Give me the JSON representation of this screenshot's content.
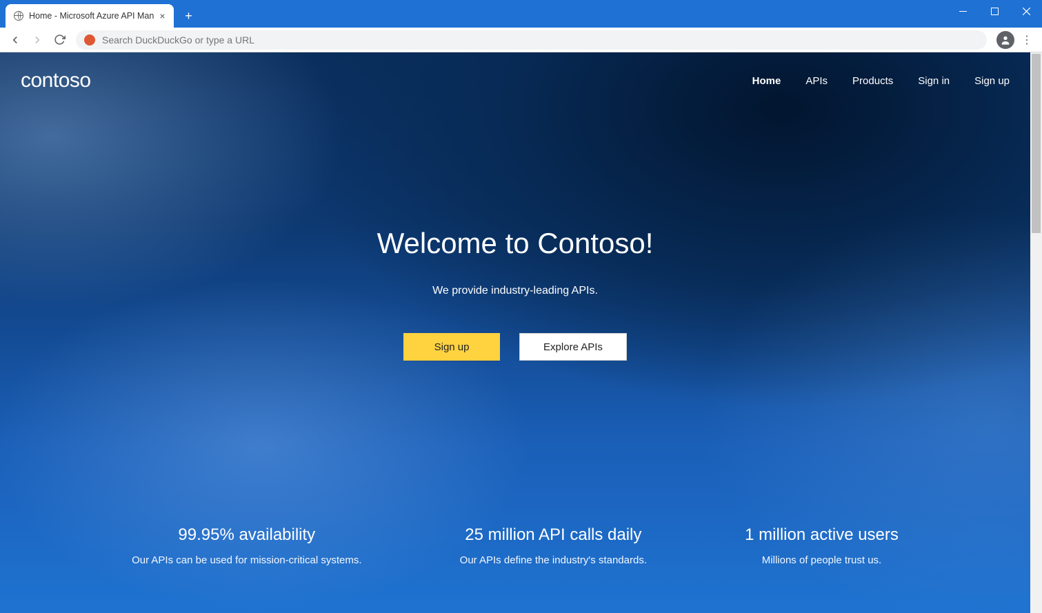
{
  "browser": {
    "tab_title": "Home - Microsoft Azure API Man",
    "omnibox_placeholder": "Search DuckDuckGo or type a URL"
  },
  "header": {
    "brand": "contoso",
    "nav": [
      {
        "label": "Home",
        "active": true
      },
      {
        "label": "APIs",
        "active": false
      },
      {
        "label": "Products",
        "active": false
      },
      {
        "label": "Sign in",
        "active": false
      },
      {
        "label": "Sign up",
        "active": false
      }
    ]
  },
  "hero": {
    "title": "Welcome to Contoso!",
    "subtitle": "We provide industry-leading APIs.",
    "primary_button": "Sign up",
    "secondary_button": "Explore APIs"
  },
  "stats": [
    {
      "headline": "99.95% availability",
      "sub": "Our APIs can be used for mission-critical systems."
    },
    {
      "headline": "25 million API calls daily",
      "sub": "Our APIs define the industry's standards."
    },
    {
      "headline": "1 million active users",
      "sub": "Millions of people trust us."
    }
  ]
}
